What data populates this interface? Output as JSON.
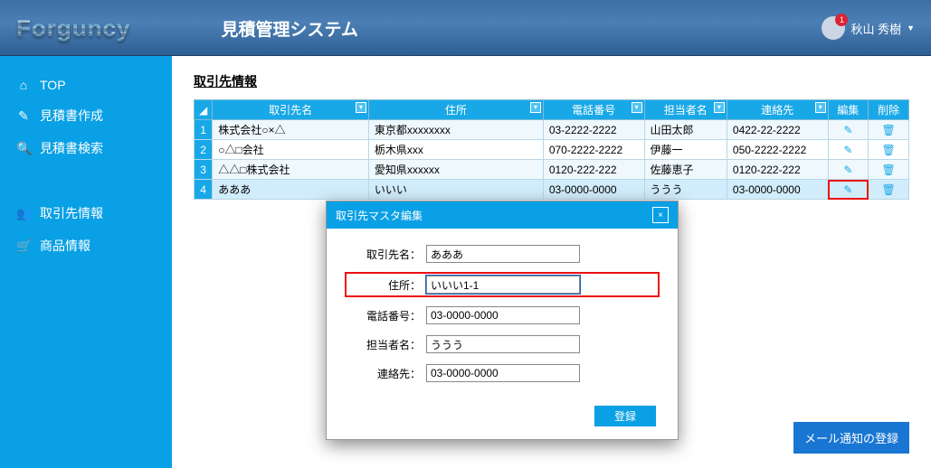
{
  "header": {
    "logo": "Forguncy",
    "system_title": "見積管理システム",
    "user_name": "秋山 秀樹",
    "badge_count": "1"
  },
  "sidebar": {
    "items": [
      {
        "icon": "⌂",
        "label": "TOP"
      },
      {
        "icon": "✎",
        "label": "見積書作成"
      },
      {
        "icon": "🔍",
        "label": "見積書検索"
      },
      {
        "icon": "👥",
        "label": "取引先情報"
      },
      {
        "icon": "🛒",
        "label": "商品情報"
      }
    ]
  },
  "page": {
    "title": "取引先情報"
  },
  "grid": {
    "headers": [
      "取引先名",
      "住所",
      "電話番号",
      "担当者名",
      "連絡先",
      "編集",
      "削除"
    ],
    "rows": [
      {
        "n": "1",
        "name": "株式会社○×△",
        "addr": "東京都xxxxxxxx",
        "tel": "03-2222-2222",
        "person": "山田太郎",
        "contact": "0422-22-2222"
      },
      {
        "n": "2",
        "name": "○△□会社",
        "addr": "栃木県xxx",
        "tel": "070-2222-2222",
        "person": "伊藤一",
        "contact": "050-2222-2222"
      },
      {
        "n": "3",
        "name": "△△□株式会社",
        "addr": "愛知県xxxxxx",
        "tel": "0120-222-222",
        "person": "佐藤恵子",
        "contact": "0120-222-222"
      },
      {
        "n": "4",
        "name": "あああ",
        "addr": "いいい",
        "tel": "03-0000-0000",
        "person": "ううう",
        "contact": "03-0000-0000"
      }
    ],
    "edit_icon": "✎",
    "delete_icon": "🗑"
  },
  "modal": {
    "title": "取引先マスタ編集",
    "labels": {
      "name": "取引先名：",
      "addr": "住所：",
      "tel": "電話番号：",
      "person": "担当者名：",
      "contact": "連絡先："
    },
    "values": {
      "name": "あああ",
      "addr": "いいい1-1",
      "tel": "03-0000-0000",
      "person": "ううう",
      "contact": "03-0000-0000"
    },
    "register": "登録",
    "close": "×"
  },
  "mail_button": "メール通知の登録"
}
